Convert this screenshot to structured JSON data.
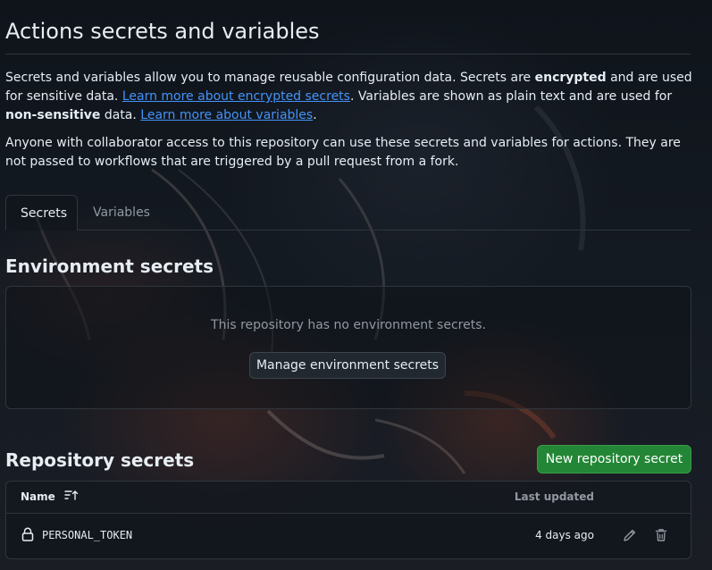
{
  "page": {
    "title": "Actions secrets and variables"
  },
  "intro": {
    "part1": "Secrets and variables allow you to manage reusable configuration data. Secrets are ",
    "bold1": "encrypted",
    "part2": " and are used for sensitive data. ",
    "link1": "Learn more about encrypted secrets",
    "part3": ". Variables are shown as plain text and are used for ",
    "bold2": "non-sensitive",
    "part4": " data. ",
    "link2": "Learn more about variables",
    "part5": "."
  },
  "note": "Anyone with collaborator access to this repository can use these secrets and variables for actions. They are not passed to workflows that are triggered by a pull request from a fork.",
  "tabs": [
    {
      "label": "Secrets",
      "active": true
    },
    {
      "label": "Variables",
      "active": false
    }
  ],
  "environment_secrets": {
    "heading": "Environment secrets",
    "empty_text": "This repository has no environment secrets.",
    "manage_button": "Manage environment secrets"
  },
  "repository_secrets": {
    "heading": "Repository secrets",
    "new_button": "New repository secret",
    "columns": {
      "name": "Name",
      "last_updated": "Last updated"
    },
    "rows": [
      {
        "name": "PERSONAL_TOKEN",
        "updated": "4 days ago"
      }
    ]
  },
  "icons": {
    "sort": "sort-ascending-icon",
    "lock": "lock-icon",
    "edit": "pencil-icon",
    "delete": "trash-icon"
  },
  "colors": {
    "accent_link": "#4493f8",
    "primary_button": "#238636",
    "border": "#30363d",
    "muted_text": "#9198a1"
  }
}
